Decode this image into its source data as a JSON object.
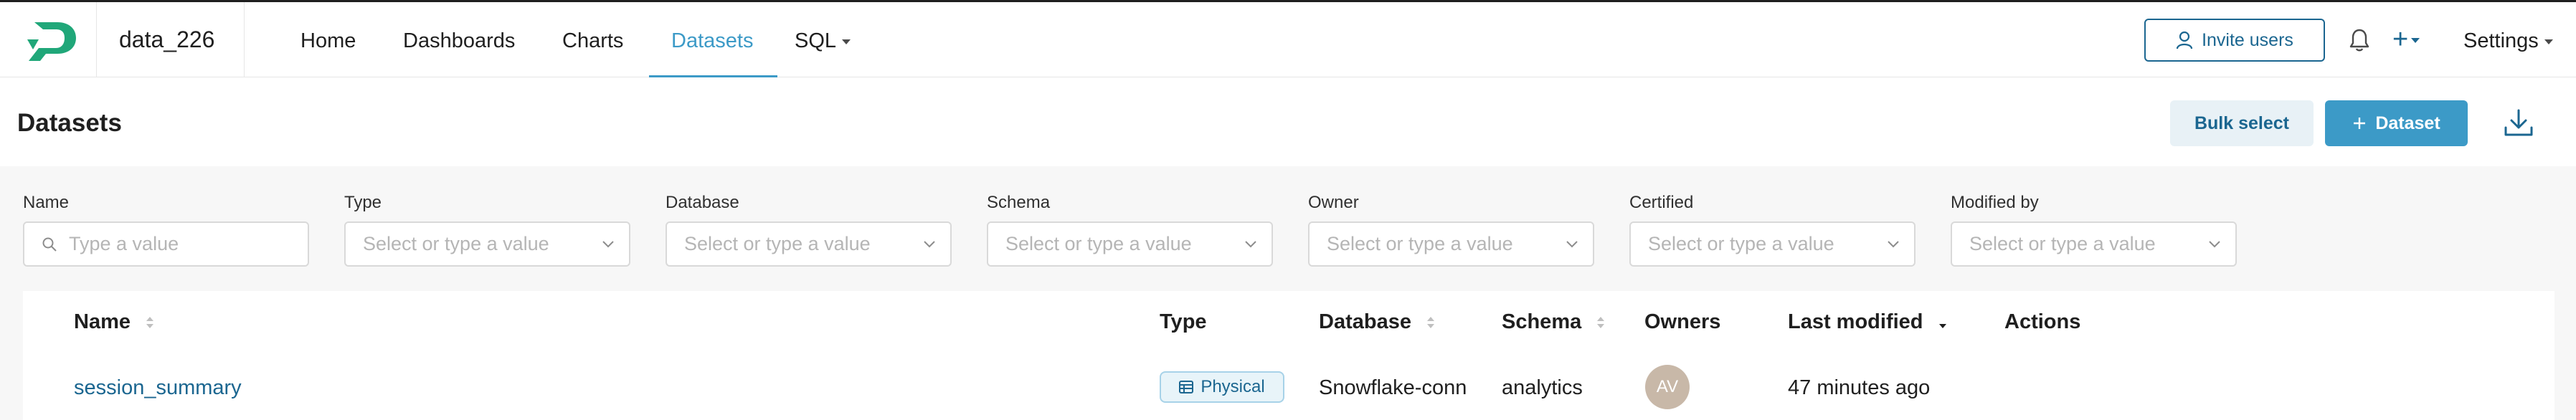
{
  "app": {
    "brand": "data_226"
  },
  "nav": {
    "items": [
      {
        "label": "Home"
      },
      {
        "label": "Dashboards"
      },
      {
        "label": "Charts"
      },
      {
        "label": "Datasets"
      },
      {
        "label": "SQL"
      }
    ],
    "active": "Datasets",
    "invite_label": "Invite users",
    "plus_label": "+",
    "settings_label": "Settings"
  },
  "page": {
    "title": "Datasets",
    "bulk_select_label": "Bulk select",
    "add_dataset_label": "Dataset"
  },
  "filters": {
    "name": {
      "label": "Name",
      "placeholder": "Type a value"
    },
    "type": {
      "label": "Type",
      "placeholder": "Select or type a value"
    },
    "database": {
      "label": "Database",
      "placeholder": "Select or type a value"
    },
    "schema": {
      "label": "Schema",
      "placeholder": "Select or type a value"
    },
    "owner": {
      "label": "Owner",
      "placeholder": "Select or type a value"
    },
    "certified": {
      "label": "Certified",
      "placeholder": "Select or type a value"
    },
    "modified_by": {
      "label": "Modified by",
      "placeholder": "Select or type a value"
    }
  },
  "table": {
    "columns": {
      "name": "Name",
      "type": "Type",
      "database": "Database",
      "schema": "Schema",
      "owners": "Owners",
      "last_modified": "Last modified",
      "actions": "Actions"
    },
    "rows": [
      {
        "name": "session_summary",
        "type": "Physical",
        "database": "Snowflake-conn",
        "schema": "analytics",
        "owner_initials": "AV",
        "last_modified": "47 minutes ago"
      }
    ]
  },
  "colors": {
    "primary": "#3c9ac7",
    "primary_dark": "#1b6690",
    "avatar": "#c8b8a8"
  }
}
